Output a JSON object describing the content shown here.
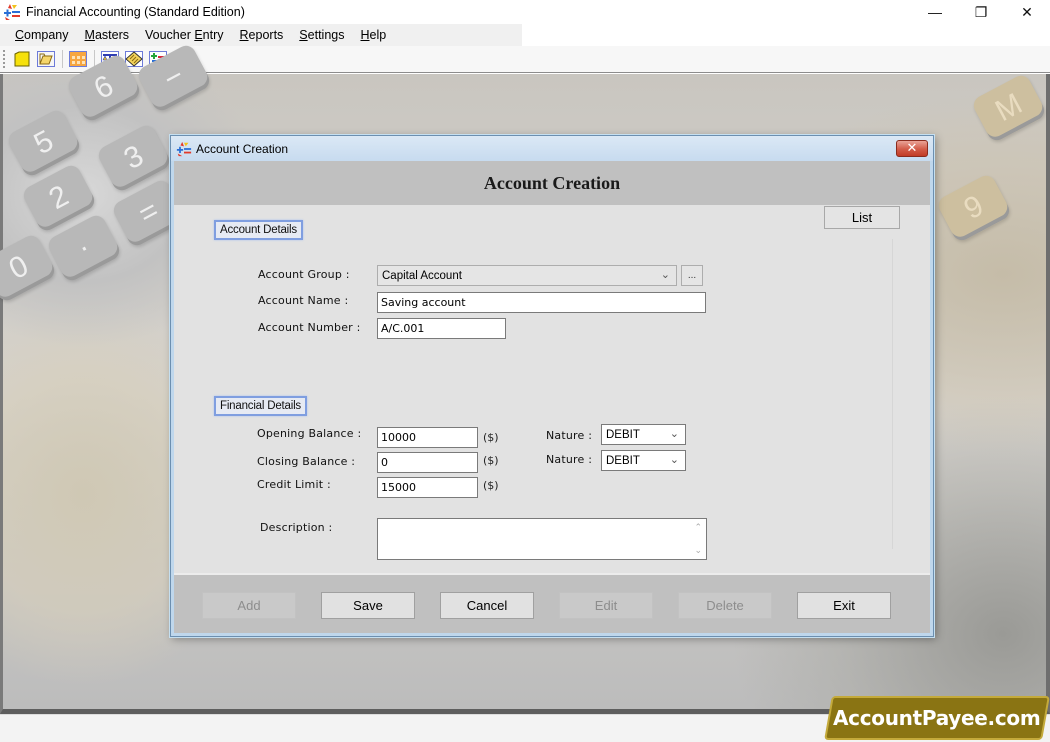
{
  "app": {
    "title": "Financial Accounting (Standard Edition)",
    "window_controls": {
      "minimize": "—",
      "restore": "❐",
      "close": "✕"
    }
  },
  "menubar": {
    "items": [
      {
        "label": "Company",
        "mnemonic": "C",
        "rest": "ompany"
      },
      {
        "label": "Masters",
        "mnemonic": "M",
        "rest": "asters"
      },
      {
        "label": "Voucher Entry",
        "pre": "Voucher ",
        "mnemonic": "E",
        "rest": "ntry"
      },
      {
        "label": "Reports",
        "mnemonic": "R",
        "rest": "eports"
      },
      {
        "label": "Settings",
        "mnemonic": "S",
        "rest": "ettings"
      },
      {
        "label": "Help",
        "mnemonic": "H",
        "rest": "elp"
      }
    ]
  },
  "toolbar": {
    "icons": [
      "new-document-icon",
      "open-folder-icon",
      "calendar-grid-icon",
      "balance-scale-icon",
      "ledger-book-icon",
      "add-remove-list-icon"
    ]
  },
  "dialog": {
    "title": "Account Creation",
    "close_label": "✕",
    "header": "Account Creation",
    "list_button": "List",
    "account_details": {
      "group_label": "Account Details",
      "account_group_label": "Account Group :",
      "account_group_value": "Capital Account",
      "browse_button": "...",
      "account_name_label": "Account Name :",
      "account_name_value": "Saving account",
      "account_number_label": "Account Number :",
      "account_number_value": "A/C.001"
    },
    "financial_details": {
      "group_label": "Financial Details",
      "opening_balance_label": "Opening Balance :",
      "opening_balance_value": "10000",
      "closing_balance_label": "Closing Balance :",
      "closing_balance_value": "0",
      "credit_limit_label": "Credit Limit :",
      "credit_limit_value": "15000",
      "currency_unit": "($)",
      "nature_label": "Nature :",
      "opening_nature_value": "DEBIT",
      "closing_nature_value": "DEBIT",
      "description_label": "Description :",
      "description_value": ""
    },
    "buttons": {
      "add": {
        "label": "Add",
        "enabled": false
      },
      "save": {
        "label": "Save",
        "enabled": true
      },
      "cancel": {
        "label": "Cancel",
        "enabled": true
      },
      "edit": {
        "label": "Edit",
        "enabled": false
      },
      "delete": {
        "label": "Delete",
        "enabled": false
      },
      "exit": {
        "label": "Exit",
        "enabled": true
      }
    }
  },
  "branding": {
    "text": "AccountPayee.com",
    "color": "#8a7413"
  }
}
